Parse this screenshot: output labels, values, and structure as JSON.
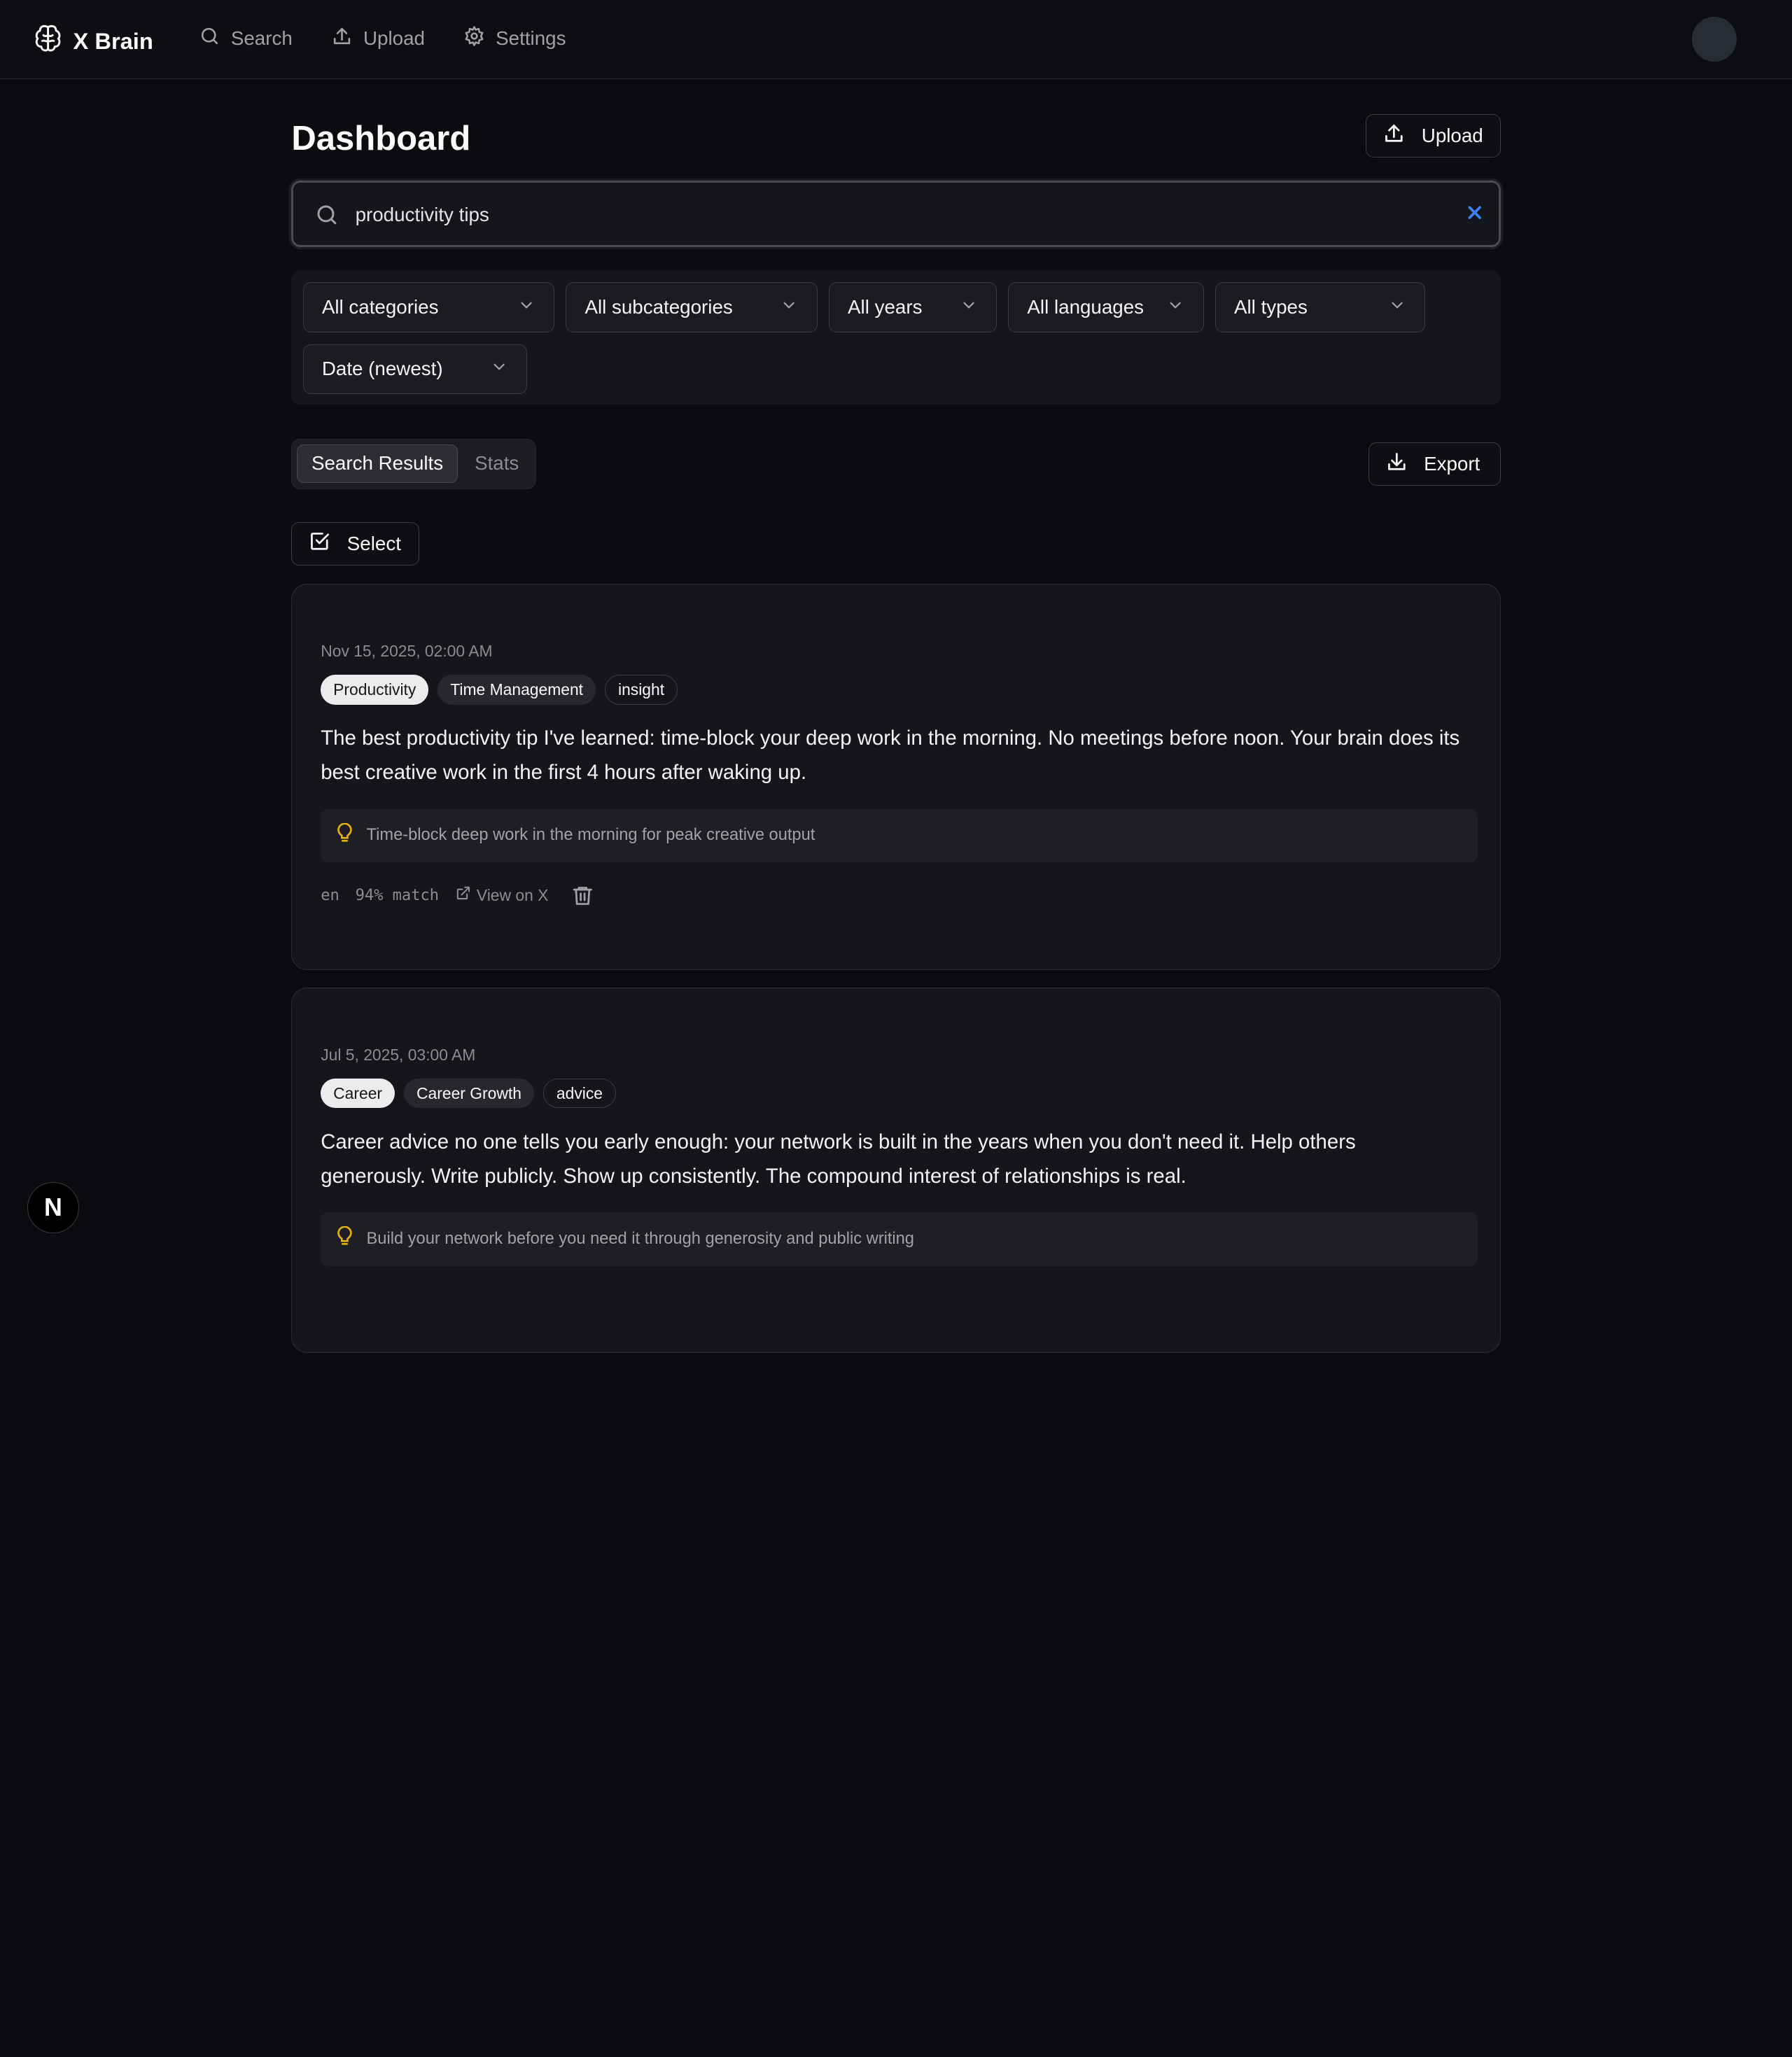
{
  "app": {
    "name": "X Brain",
    "logo_icon": "brain-icon"
  },
  "nav": [
    {
      "label": "Search",
      "icon": "search-icon"
    },
    {
      "label": "Upload",
      "icon": "upload-icon"
    },
    {
      "label": "Settings",
      "icon": "gear-icon"
    }
  ],
  "page": {
    "title": "Dashboard",
    "upload_label": "Upload"
  },
  "search": {
    "value": "productivity tips",
    "clear_icon": "close-icon"
  },
  "filters": {
    "category": "All categories",
    "subcategory": "All subcategories",
    "year": "All years",
    "language": "All languages",
    "type": "All types",
    "sort": "Date (newest)"
  },
  "tabs": {
    "active": "Search Results",
    "inactive": "Stats"
  },
  "actions": {
    "export_label": "Export",
    "select_label": "Select"
  },
  "results": [
    {
      "date": "Nov 15, 2025, 02:00 AM",
      "tags": [
        "Productivity",
        "Time Management",
        "insight"
      ],
      "text": "The best productivity tip I've learned: time-block your deep work in the morning. No meetings before noon. Your brain does its best creative work in the first 4 hours after waking up.",
      "insight": "Time-block deep work in the morning for peak creative output",
      "language": "en",
      "match": "94% match",
      "view_label": "View on X"
    },
    {
      "date": "Jul 5, 2025, 03:00 AM",
      "tags": [
        "Career",
        "Career Growth",
        "advice"
      ],
      "text": "Career advice no one tells you early enough: your network is built in the years when you don't need it. Help others generously. Write publicly. Show up consistently. The compound interest of relationships is real.",
      "insight": "Build your network before you need it through generosity and public writing"
    }
  ],
  "colors": {
    "accent_clear": "#3b82f6",
    "insight_bulb": "#eab308"
  },
  "dev_badge": "N"
}
